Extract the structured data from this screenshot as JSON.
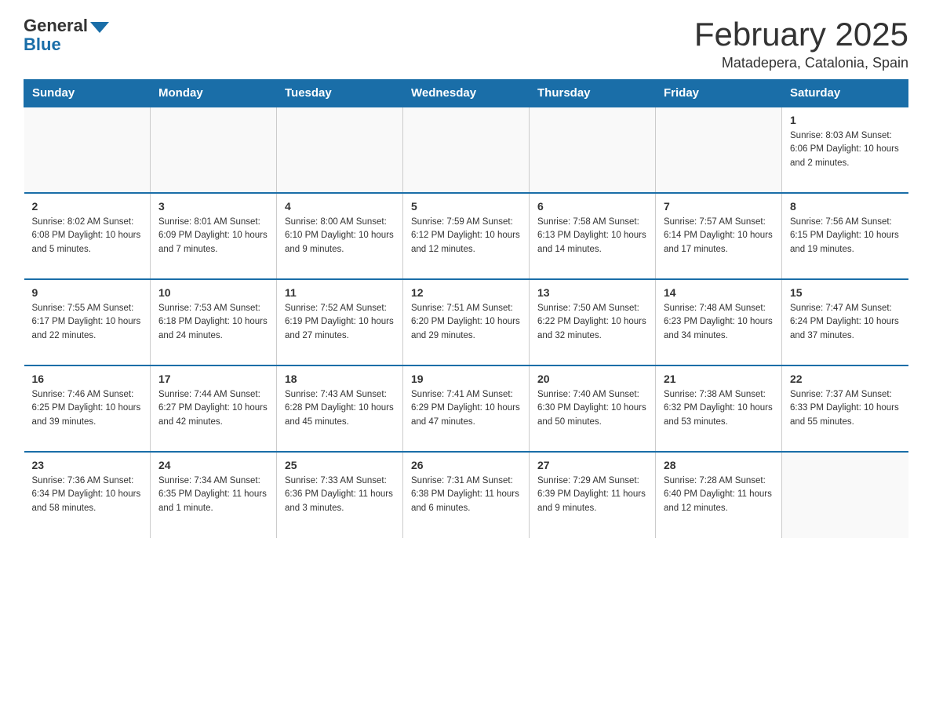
{
  "header": {
    "logo_general": "General",
    "logo_blue": "Blue",
    "month_title": "February 2025",
    "location": "Matadepera, Catalonia, Spain"
  },
  "days_of_week": [
    "Sunday",
    "Monday",
    "Tuesday",
    "Wednesday",
    "Thursday",
    "Friday",
    "Saturday"
  ],
  "weeks": [
    [
      {
        "day": "",
        "info": ""
      },
      {
        "day": "",
        "info": ""
      },
      {
        "day": "",
        "info": ""
      },
      {
        "day": "",
        "info": ""
      },
      {
        "day": "",
        "info": ""
      },
      {
        "day": "",
        "info": ""
      },
      {
        "day": "1",
        "info": "Sunrise: 8:03 AM\nSunset: 6:06 PM\nDaylight: 10 hours and 2 minutes."
      }
    ],
    [
      {
        "day": "2",
        "info": "Sunrise: 8:02 AM\nSunset: 6:08 PM\nDaylight: 10 hours and 5 minutes."
      },
      {
        "day": "3",
        "info": "Sunrise: 8:01 AM\nSunset: 6:09 PM\nDaylight: 10 hours and 7 minutes."
      },
      {
        "day": "4",
        "info": "Sunrise: 8:00 AM\nSunset: 6:10 PM\nDaylight: 10 hours and 9 minutes."
      },
      {
        "day": "5",
        "info": "Sunrise: 7:59 AM\nSunset: 6:12 PM\nDaylight: 10 hours and 12 minutes."
      },
      {
        "day": "6",
        "info": "Sunrise: 7:58 AM\nSunset: 6:13 PM\nDaylight: 10 hours and 14 minutes."
      },
      {
        "day": "7",
        "info": "Sunrise: 7:57 AM\nSunset: 6:14 PM\nDaylight: 10 hours and 17 minutes."
      },
      {
        "day": "8",
        "info": "Sunrise: 7:56 AM\nSunset: 6:15 PM\nDaylight: 10 hours and 19 minutes."
      }
    ],
    [
      {
        "day": "9",
        "info": "Sunrise: 7:55 AM\nSunset: 6:17 PM\nDaylight: 10 hours and 22 minutes."
      },
      {
        "day": "10",
        "info": "Sunrise: 7:53 AM\nSunset: 6:18 PM\nDaylight: 10 hours and 24 minutes."
      },
      {
        "day": "11",
        "info": "Sunrise: 7:52 AM\nSunset: 6:19 PM\nDaylight: 10 hours and 27 minutes."
      },
      {
        "day": "12",
        "info": "Sunrise: 7:51 AM\nSunset: 6:20 PM\nDaylight: 10 hours and 29 minutes."
      },
      {
        "day": "13",
        "info": "Sunrise: 7:50 AM\nSunset: 6:22 PM\nDaylight: 10 hours and 32 minutes."
      },
      {
        "day": "14",
        "info": "Sunrise: 7:48 AM\nSunset: 6:23 PM\nDaylight: 10 hours and 34 minutes."
      },
      {
        "day": "15",
        "info": "Sunrise: 7:47 AM\nSunset: 6:24 PM\nDaylight: 10 hours and 37 minutes."
      }
    ],
    [
      {
        "day": "16",
        "info": "Sunrise: 7:46 AM\nSunset: 6:25 PM\nDaylight: 10 hours and 39 minutes."
      },
      {
        "day": "17",
        "info": "Sunrise: 7:44 AM\nSunset: 6:27 PM\nDaylight: 10 hours and 42 minutes."
      },
      {
        "day": "18",
        "info": "Sunrise: 7:43 AM\nSunset: 6:28 PM\nDaylight: 10 hours and 45 minutes."
      },
      {
        "day": "19",
        "info": "Sunrise: 7:41 AM\nSunset: 6:29 PM\nDaylight: 10 hours and 47 minutes."
      },
      {
        "day": "20",
        "info": "Sunrise: 7:40 AM\nSunset: 6:30 PM\nDaylight: 10 hours and 50 minutes."
      },
      {
        "day": "21",
        "info": "Sunrise: 7:38 AM\nSunset: 6:32 PM\nDaylight: 10 hours and 53 minutes."
      },
      {
        "day": "22",
        "info": "Sunrise: 7:37 AM\nSunset: 6:33 PM\nDaylight: 10 hours and 55 minutes."
      }
    ],
    [
      {
        "day": "23",
        "info": "Sunrise: 7:36 AM\nSunset: 6:34 PM\nDaylight: 10 hours and 58 minutes."
      },
      {
        "day": "24",
        "info": "Sunrise: 7:34 AM\nSunset: 6:35 PM\nDaylight: 11 hours and 1 minute."
      },
      {
        "day": "25",
        "info": "Sunrise: 7:33 AM\nSunset: 6:36 PM\nDaylight: 11 hours and 3 minutes."
      },
      {
        "day": "26",
        "info": "Sunrise: 7:31 AM\nSunset: 6:38 PM\nDaylight: 11 hours and 6 minutes."
      },
      {
        "day": "27",
        "info": "Sunrise: 7:29 AM\nSunset: 6:39 PM\nDaylight: 11 hours and 9 minutes."
      },
      {
        "day": "28",
        "info": "Sunrise: 7:28 AM\nSunset: 6:40 PM\nDaylight: 11 hours and 12 minutes."
      },
      {
        "day": "",
        "info": ""
      }
    ]
  ]
}
